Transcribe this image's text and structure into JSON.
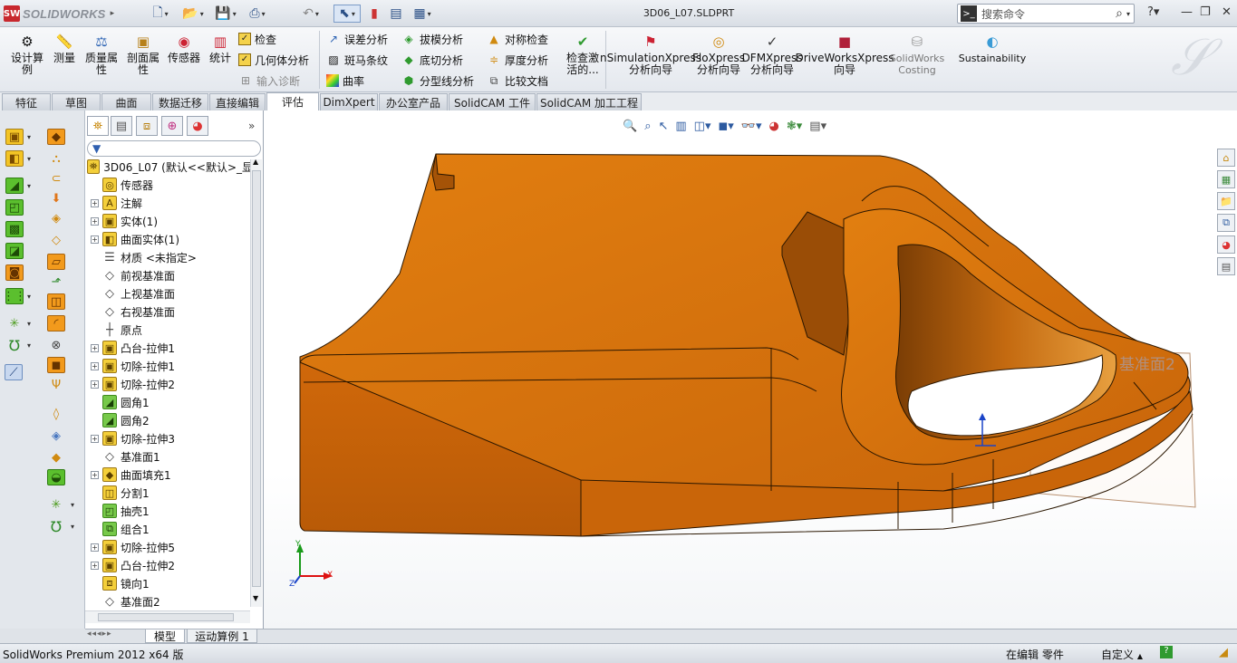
{
  "app": {
    "logo_text": "SOLIDWORKS",
    "doc_title": "3D06_L07.SLDPRT"
  },
  "search": {
    "placeholder": "搜索命令"
  },
  "ribbon": {
    "design_study": "设计算例",
    "measure": "测量",
    "mass_props": "质量属性",
    "section_props": "剖面属性",
    "sensor": "传感器",
    "statistics": "统计",
    "check": "检查",
    "geometry_analysis": "几何体分析",
    "import_diagnostics": "输入诊断",
    "deviation_analysis": "误差分析",
    "zebra_stripes": "斑马条纹",
    "curvature": "曲率",
    "draft_analysis": "拔模分析",
    "undercut_analysis": "底切分析",
    "parting_line_analysis": "分型线分析",
    "symmetry_check": "对称检查",
    "thickness_analysis": "厚度分析",
    "compare_documents": "比较文档",
    "check_active": "检查激活的...",
    "simxpress": "nSimulationXpress\n分析向导",
    "floxpress": "FloXpress\n分析向导",
    "dfmxpress": "DFMXpress\n分析向导",
    "driveworks": "DriveWorksXpress\n向导",
    "costing": "SolidWorks\nCosting",
    "sustainability": "Sustainability"
  },
  "tabs": [
    {
      "label": "特征"
    },
    {
      "label": "草图"
    },
    {
      "label": "曲面"
    },
    {
      "label": "数据迁移"
    },
    {
      "label": "直接编辑"
    },
    {
      "label": "评估"
    },
    {
      "label": "DimXpert"
    },
    {
      "label": "办公室产品"
    },
    {
      "label": "SolidCAM 工件"
    },
    {
      "label": "SolidCAM 加工工程"
    }
  ],
  "tree": {
    "root": "3D06_L07 (默认<<默认>_显",
    "items": [
      {
        "label": "传感器",
        "icon": "sensor-icon",
        "expandable": false
      },
      {
        "label": "注解",
        "icon": "annotations-icon",
        "expandable": true
      },
      {
        "label": "实体(1)",
        "icon": "solid-bodies-icon",
        "expandable": true
      },
      {
        "label": "曲面实体(1)",
        "icon": "surface-bodies-icon",
        "expandable": true
      },
      {
        "label": "材质 <未指定>",
        "icon": "material-icon",
        "expandable": false
      },
      {
        "label": "前视基准面",
        "icon": "plane-icon",
        "expandable": false
      },
      {
        "label": "上视基准面",
        "icon": "plane-icon",
        "expandable": false
      },
      {
        "label": "右视基准面",
        "icon": "plane-icon",
        "expandable": false
      },
      {
        "label": "原点",
        "icon": "origin-icon",
        "expandable": false
      },
      {
        "label": "凸台-拉伸1",
        "icon": "boss-extrude-icon",
        "expandable": true
      },
      {
        "label": "切除-拉伸1",
        "icon": "cut-extrude-icon",
        "expandable": true
      },
      {
        "label": "切除-拉伸2",
        "icon": "cut-extrude-icon",
        "expandable": true
      },
      {
        "label": "圆角1",
        "icon": "fillet-icon",
        "expandable": false
      },
      {
        "label": "圆角2",
        "icon": "fillet-icon",
        "expandable": false
      },
      {
        "label": "切除-拉伸3",
        "icon": "cut-extrude-icon",
        "expandable": true
      },
      {
        "label": "基准面1",
        "icon": "plane-icon",
        "expandable": false
      },
      {
        "label": "曲面填充1",
        "icon": "fill-surface-icon",
        "expandable": true
      },
      {
        "label": "分割1",
        "icon": "split-icon",
        "expandable": false
      },
      {
        "label": "抽壳1",
        "icon": "shell-icon",
        "expandable": false
      },
      {
        "label": "组合1",
        "icon": "combine-icon",
        "expandable": false
      },
      {
        "label": "切除-拉伸5",
        "icon": "cut-extrude-icon",
        "expandable": true
      },
      {
        "label": "凸台-拉伸2",
        "icon": "boss-extrude-icon",
        "expandable": true
      },
      {
        "label": "镜向1",
        "icon": "mirror-icon",
        "expandable": false
      },
      {
        "label": "基准面2",
        "icon": "plane-icon",
        "expandable": false
      }
    ]
  },
  "viewport": {
    "plane_label": "基准面2",
    "axis_x": "X",
    "axis_y": "Y",
    "axis_z": "Z"
  },
  "bottom_tabs": [
    {
      "label": "模型"
    },
    {
      "label": "运动算例 1"
    }
  ],
  "status": {
    "product": "SolidWorks Premium 2012 x64 版",
    "mode": "在编辑 零件",
    "units": "自定义"
  },
  "colors": {
    "part_orange": "#e07c0a",
    "accent_blue": "#2c5aa0"
  }
}
